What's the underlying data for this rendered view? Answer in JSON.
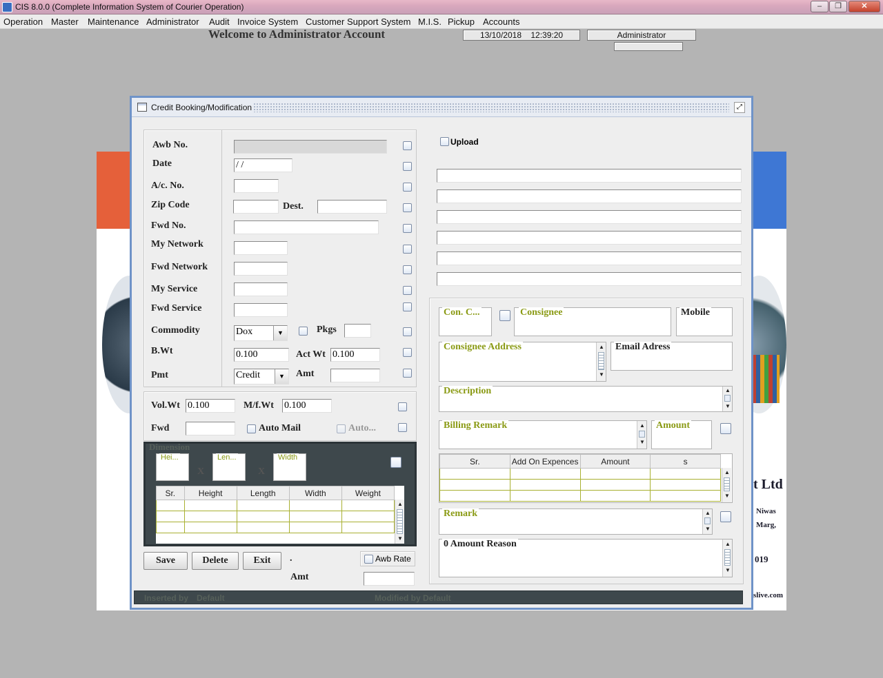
{
  "window": {
    "title": "CIS 8.0.0 (Complete Information System of Courier Operation)"
  },
  "menu": [
    "Operation",
    "Master",
    "Maintenance",
    "Administrator",
    "Audit",
    "Invoice System",
    "Customer Support System",
    "M.I.S.",
    "Pickup",
    "Accounts"
  ],
  "header": {
    "welcome": "Welcome to Administrator Account",
    "date": "13/10/2018",
    "time": "12:39:20",
    "user": "Administrator"
  },
  "background": {
    "company_fragment": "t Ltd",
    "address1": "Niwas",
    "address2": "Marg,",
    "pin": "019",
    "web": "slive.com"
  },
  "frame": {
    "title": "Credit Booking/Modification"
  },
  "form": {
    "awb_no": "Awb No.",
    "date": "Date",
    "date_value": " /  /",
    "ac_no": "A/c. No.",
    "zip_code": "Zip Code",
    "dest": "Dest.",
    "fwd_no": "Fwd No.",
    "my_network": "My Network",
    "fwd_network": "Fwd Network",
    "my_service": "My Service",
    "fwd_service": "Fwd Service",
    "commodity": "Commodity",
    "commodity_value": "Dox",
    "pkgs": "Pkgs",
    "bwt": "B.Wt",
    "bwt_value": "0.100",
    "act_wt": "Act Wt",
    "act_wt_value": "0.100",
    "pmt": "Pmt",
    "pmt_value": "Credit",
    "amt": "Amt",
    "vol_wt": "Vol.Wt",
    "vol_wt_value": "0.100",
    "mf_wt": "M/f.Wt",
    "mf_wt_value": "0.100",
    "fwd": "Fwd",
    "auto_mail": "Auto Mail",
    "auto": "Auto..."
  },
  "dimension": {
    "title": "Dimension",
    "height": "Hei...",
    "length": "Len...",
    "width": "Width",
    "x": "X",
    "columns": [
      "Sr.",
      "Height",
      "Length",
      "Width",
      "Weight"
    ]
  },
  "buttons": {
    "save": "Save",
    "delete": "Delete",
    "exit": "Exit",
    "dot": ".",
    "awb_rate": "Awb Rate",
    "amt": "Amt"
  },
  "right": {
    "upload": "Upload",
    "con_c": "Con. C...",
    "consignee": "Consignee",
    "mobile": "Mobile",
    "consignee_address": "Consignee Address",
    "email_address": "Email Adress",
    "description": "Description",
    "billing_remark": "Billing Remark",
    "amount": "Amount",
    "expense_columns": [
      "Sr.",
      "Add On Expences",
      "Amount",
      "s"
    ],
    "remark": "Remark",
    "zero_amount_reason": "0 Amount Reason"
  },
  "status": {
    "inserted_label": "Inserted by",
    "inserted_value": "Default",
    "modified_label": "Modified by",
    "modified_value": "Default"
  }
}
